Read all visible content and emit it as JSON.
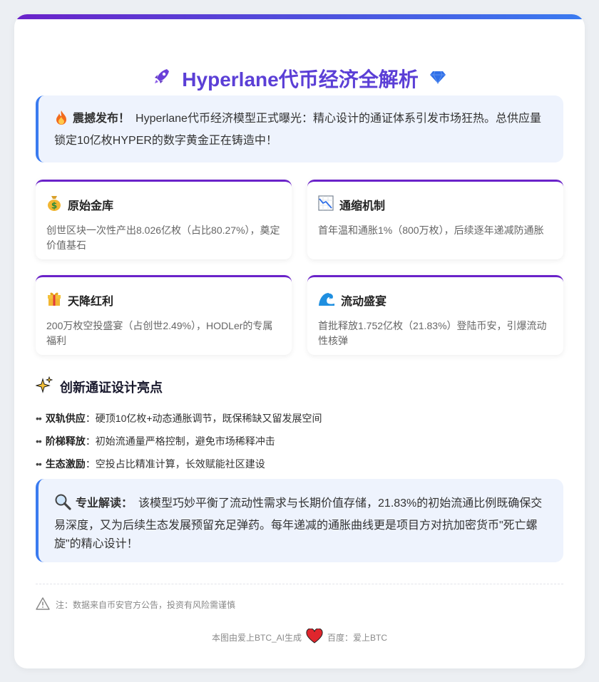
{
  "title": "Hyperlane代币经济全解析",
  "colors": {
    "accent": "#5b3fd6",
    "gradient_start": "#6a22c9",
    "gradient_end": "#3a7bf0",
    "alert_bg": "#eef3fd"
  },
  "alert": {
    "icon": "fire-icon",
    "lead": "震撼发布！",
    "text": "Hyperlane代币经济模型正式曝光：精心设计的通证体系引发市场狂热。总供应量锁定10亿枚HYPER的数字黄金正在铸造中！"
  },
  "stats": [
    {
      "icon": "money-bag-icon",
      "name": "原始金库",
      "desc": "创世区块一次性产出8.026亿枚（占比80.27%），奠定价值基石"
    },
    {
      "icon": "chart-decreasing-icon",
      "name": "通缩机制",
      "desc": "首年温和通胀1%（800万枚），后续逐年递减防通胀"
    },
    {
      "icon": "gift-icon",
      "name": "天降红利",
      "desc": "200万枚空投盛宴（占创世2.49%），HODLer的专属福利"
    },
    {
      "icon": "wave-icon",
      "name": "流动盛宴",
      "desc": "首批释放1.752亿枚（21.83%）登陆币安，引爆流动性核弹"
    }
  ],
  "section": {
    "icon": "sparkles-icon",
    "title": "创新通证设计亮点"
  },
  "bullets": [
    {
      "key": "双轨供应",
      "text": "：硬顶10亿枚+动态通胀调节，既保稀缺又留发展空间"
    },
    {
      "key": "阶梯释放",
      "text": "：初始流通量严格控制，避免市场稀释冲击"
    },
    {
      "key": "生态激励",
      "text": "：空投占比精准计算，长效赋能社区建设"
    }
  ],
  "analysis": {
    "icon": "magnifier-icon",
    "lead": "专业解读：",
    "text": "该模型巧妙平衡了流动性需求与长期价值存储，21.83%的初始流通比例既确保交易深度，又为后续生态发展预留充足弹药。每年递减的通胀曲线更是项目方对抗加密货币\"死亡螺旋\"的精心设计！"
  },
  "note": {
    "icon": "warning-icon",
    "text": "注：数据来自币安官方公告，投资有风险需谨慎"
  },
  "footer": {
    "left": "本图由爱上BTC_AI生成",
    "right": "百度：爱上BTC",
    "icon": "heart-icon"
  }
}
